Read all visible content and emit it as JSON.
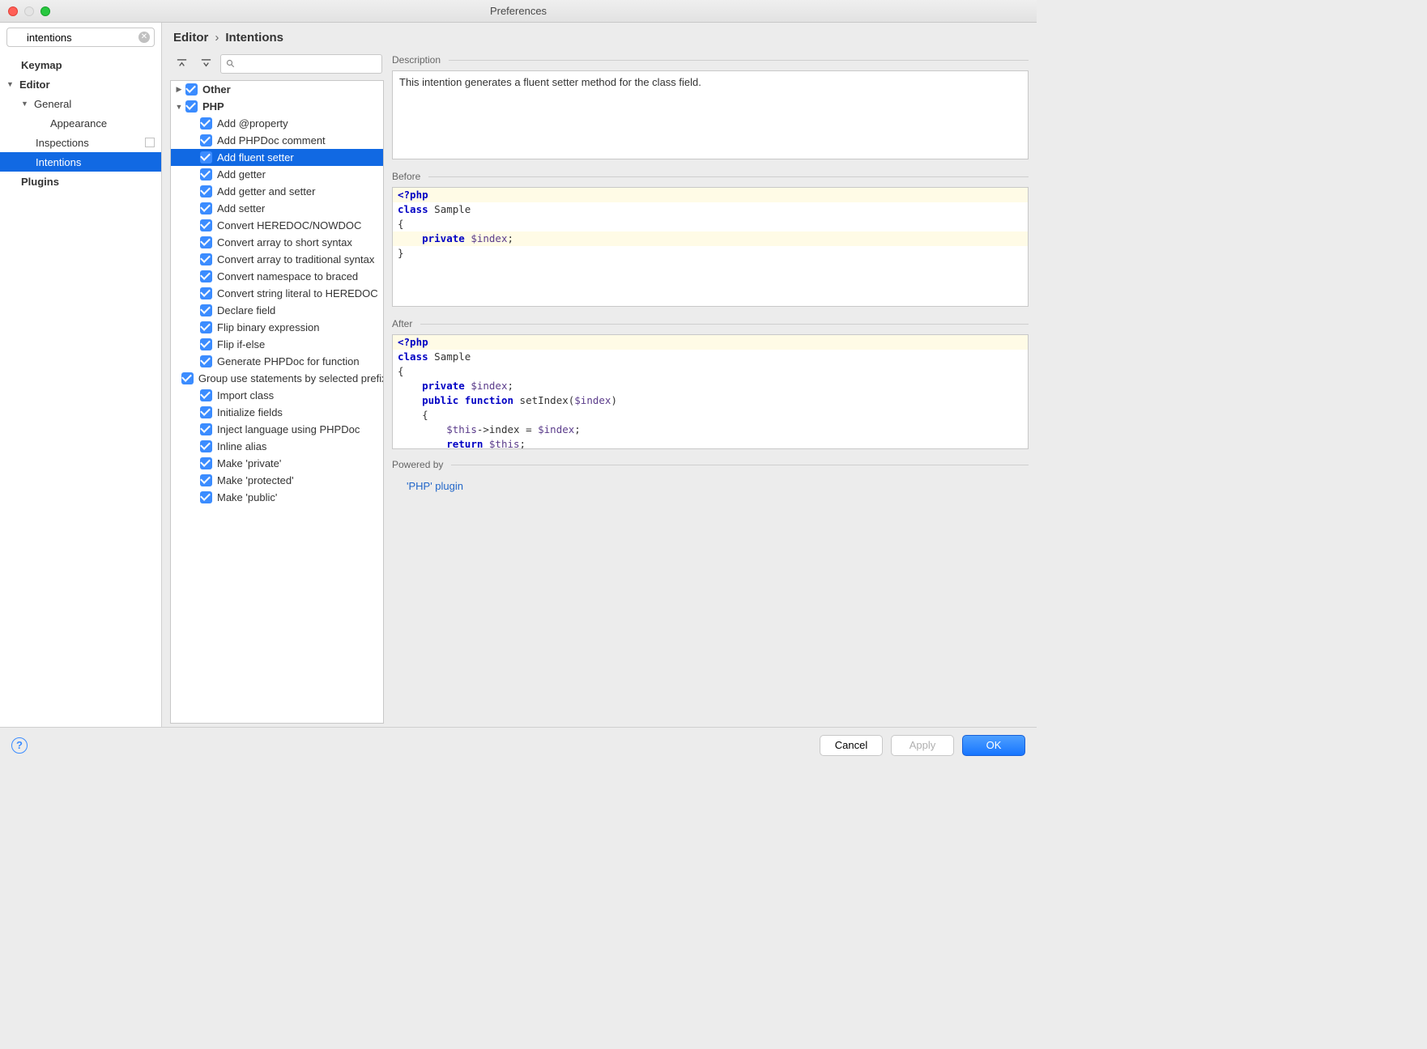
{
  "window": {
    "title": "Preferences"
  },
  "search": {
    "value": "intentions"
  },
  "sidebar": {
    "items": [
      {
        "label": "Keymap",
        "indent": 1,
        "bold": true
      },
      {
        "label": "Editor",
        "indent": 0,
        "bold": true,
        "disclosure": "down"
      },
      {
        "label": "General",
        "indent": 1,
        "disclosure": "down"
      },
      {
        "label": "Appearance",
        "indent": 3
      },
      {
        "label": "Inspections",
        "indent": 2,
        "copy": true
      },
      {
        "label": "Intentions",
        "indent": 2,
        "selected": true
      },
      {
        "label": "Plugins",
        "indent": 1,
        "bold": true
      }
    ]
  },
  "breadcrumb": {
    "a": "Editor",
    "b": "Intentions"
  },
  "tree": {
    "groups": [
      {
        "label": "Other",
        "disclosure": "right"
      },
      {
        "label": "PHP",
        "disclosure": "down"
      }
    ],
    "items": [
      "Add @property",
      "Add PHPDoc comment",
      "Add fluent setter",
      "Add getter",
      "Add getter and setter",
      "Add setter",
      "Convert HEREDOC/NOWDOC",
      "Convert array to short syntax",
      "Convert array to traditional syntax",
      "Convert namespace to braced",
      "Convert string literal to HEREDOC",
      "Declare field",
      "Flip binary expression",
      "Flip if-else",
      "Generate PHPDoc for function",
      "Group use statements by selected prefix",
      "Import class",
      "Initialize fields",
      "Inject language using PHPDoc",
      "Inline alias",
      "Make 'private'",
      "Make 'protected'",
      "Make 'public'"
    ],
    "selectedIndex": 2
  },
  "sections": {
    "desc": "Description",
    "before": "Before",
    "after": "After",
    "powered": "Powered by"
  },
  "description": "This intention generates a fluent setter method for the class field.",
  "before": [
    {
      "tokens": [
        [
          "kw",
          "<?php"
        ]
      ],
      "hl": true
    },
    {
      "tokens": [
        [
          "kw",
          "class"
        ],
        [
          "",
          " Sample"
        ]
      ]
    },
    {
      "tokens": [
        [
          "",
          "{"
        ]
      ]
    },
    {
      "tokens": [
        [
          "",
          "    "
        ],
        [
          "kw",
          "private"
        ],
        [
          "",
          " "
        ],
        [
          "var",
          "$index"
        ],
        [
          "",
          ";"
        ]
      ],
      "hl": true
    },
    {
      "tokens": [
        [
          "",
          "}"
        ]
      ]
    }
  ],
  "after": [
    {
      "tokens": [
        [
          "kw",
          "<?php"
        ]
      ],
      "hl": true
    },
    {
      "tokens": [
        [
          "kw",
          "class"
        ],
        [
          "",
          " Sample"
        ]
      ]
    },
    {
      "tokens": [
        [
          "",
          "{"
        ]
      ]
    },
    {
      "tokens": [
        [
          "",
          "    "
        ],
        [
          "kw",
          "private"
        ],
        [
          "",
          " "
        ],
        [
          "var",
          "$index"
        ],
        [
          "",
          ";"
        ]
      ]
    },
    {
      "tokens": [
        [
          "",
          ""
        ]
      ]
    },
    {
      "tokens": [
        [
          "",
          "    "
        ],
        [
          "kw",
          "public"
        ],
        [
          "",
          " "
        ],
        [
          "kw",
          "function"
        ],
        [
          "",
          " setIndex("
        ],
        [
          "var",
          "$index"
        ],
        [
          "",
          ")"
        ]
      ]
    },
    {
      "tokens": [
        [
          "",
          "    {"
        ]
      ]
    },
    {
      "tokens": [
        [
          "",
          "        "
        ],
        [
          "var",
          "$this"
        ],
        [
          "",
          "->index = "
        ],
        [
          "var",
          "$index"
        ],
        [
          "",
          ";"
        ]
      ]
    },
    {
      "tokens": [
        [
          "",
          "        "
        ],
        [
          "kw",
          "return"
        ],
        [
          "",
          " "
        ],
        [
          "var",
          "$this"
        ],
        [
          "",
          ";"
        ]
      ]
    }
  ],
  "powered_link": "'PHP' plugin",
  "buttons": {
    "cancel": "Cancel",
    "apply": "Apply",
    "ok": "OK"
  }
}
